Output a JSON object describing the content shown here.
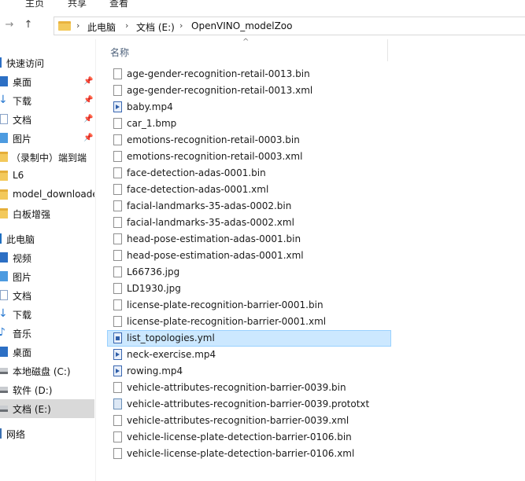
{
  "ribbon": {
    "tabs": [
      "主页",
      "共享",
      "查看"
    ]
  },
  "address": {
    "crumbs": [
      "此电脑",
      "文档 (E:)",
      "OpenVINO_modelZoo"
    ]
  },
  "nav_pane": {
    "items": [
      {
        "label": "快速访问",
        "icon": "star-icon"
      },
      {
        "label": "桌面",
        "icon": "desktop-icon",
        "pinned": true
      },
      {
        "label": "下载",
        "icon": "download-icon",
        "pinned": true
      },
      {
        "label": "文档",
        "icon": "document-icon",
        "pinned": true
      },
      {
        "label": "图片",
        "icon": "pictures-icon",
        "pinned": true
      },
      {
        "label": "（录制中）端到端",
        "icon": "folder-icon"
      },
      {
        "label": "L6",
        "icon": "folder-icon"
      },
      {
        "label": "model_downloade",
        "icon": "folder-icon"
      },
      {
        "label": "白板增强",
        "icon": "folder-icon"
      },
      {
        "label": "此电脑",
        "icon": "computer-icon"
      },
      {
        "label": "视频",
        "icon": "videos-icon"
      },
      {
        "label": "图片",
        "icon": "pictures-icon"
      },
      {
        "label": "文档",
        "icon": "document-icon"
      },
      {
        "label": "下载",
        "icon": "download-icon"
      },
      {
        "label": "音乐",
        "icon": "music-icon"
      },
      {
        "label": "桌面",
        "icon": "desktop-icon"
      },
      {
        "label": "本地磁盘 (C:)",
        "icon": "drive-icon"
      },
      {
        "label": "软件 (D:)",
        "icon": "drive-icon"
      },
      {
        "label": "文档 (E:)",
        "icon": "drive-icon",
        "selected": true
      },
      {
        "label": "网络",
        "icon": "network-icon"
      }
    ]
  },
  "file_list": {
    "column_name": "名称",
    "files": [
      {
        "name": "age-gender-recognition-retail-0013.bin",
        "type": "file"
      },
      {
        "name": "age-gender-recognition-retail-0013.xml",
        "type": "file"
      },
      {
        "name": "baby.mp4",
        "type": "media"
      },
      {
        "name": "car_1.bmp",
        "type": "file"
      },
      {
        "name": "emotions-recognition-retail-0003.bin",
        "type": "file"
      },
      {
        "name": "emotions-recognition-retail-0003.xml",
        "type": "file"
      },
      {
        "name": "face-detection-adas-0001.bin",
        "type": "file"
      },
      {
        "name": "face-detection-adas-0001.xml",
        "type": "file"
      },
      {
        "name": "facial-landmarks-35-adas-0002.bin",
        "type": "file"
      },
      {
        "name": "facial-landmarks-35-adas-0002.xml",
        "type": "file"
      },
      {
        "name": "head-pose-estimation-adas-0001.bin",
        "type": "file"
      },
      {
        "name": "head-pose-estimation-adas-0001.xml",
        "type": "file"
      },
      {
        "name": "L66736.jpg",
        "type": "file"
      },
      {
        "name": "LD1930.jpg",
        "type": "file"
      },
      {
        "name": "license-plate-recognition-barrier-0001.bin",
        "type": "file"
      },
      {
        "name": "license-plate-recognition-barrier-0001.xml",
        "type": "file"
      },
      {
        "name": "list_topologies.yml",
        "type": "yml",
        "selected": true
      },
      {
        "name": "neck-exercise.mp4",
        "type": "media"
      },
      {
        "name": "rowing.mp4",
        "type": "media"
      },
      {
        "name": "vehicle-attributes-recognition-barrier-0039.bin",
        "type": "file"
      },
      {
        "name": "vehicle-attributes-recognition-barrier-0039.prototxt",
        "type": "proto"
      },
      {
        "name": "vehicle-attributes-recognition-barrier-0039.xml",
        "type": "file"
      },
      {
        "name": "vehicle-license-plate-detection-barrier-0106.bin",
        "type": "file"
      },
      {
        "name": "vehicle-license-plate-detection-barrier-0106.xml",
        "type": "file"
      }
    ]
  }
}
